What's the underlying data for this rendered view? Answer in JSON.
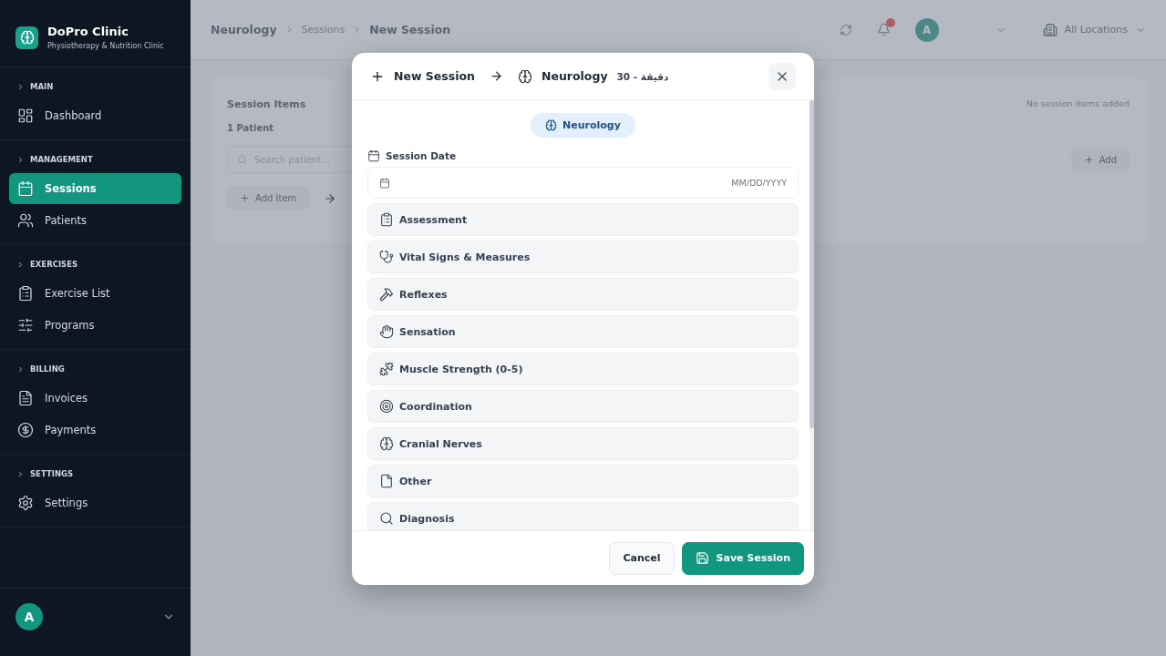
{
  "sidebar": {
    "brand": {
      "name": "DoPro Clinic",
      "subtitle": "Physiotherapy & Nutrition Clinic"
    },
    "sections": [
      {
        "title": "MAIN",
        "items": [
          {
            "label": "Dashboard",
            "selected": false
          }
        ]
      },
      {
        "title": "MANAGEMENT",
        "items": [
          {
            "label": "Sessions",
            "selected": true
          },
          {
            "label": "Patients",
            "selected": false
          }
        ]
      },
      {
        "title": "EXERCISES",
        "items": [
          {
            "label": "Exercise List",
            "selected": false
          },
          {
            "label": "Programs",
            "selected": false
          }
        ]
      },
      {
        "title": "BILLING",
        "items": [
          {
            "label": "Invoices",
            "selected": false
          },
          {
            "label": "Payments",
            "selected": false
          }
        ]
      },
      {
        "title": "SETTINGS",
        "items": [
          {
            "label": "Settings",
            "selected": false
          }
        ]
      }
    ],
    "user": {
      "avatar": "A"
    }
  },
  "header": {
    "breadcrumb": [
      "Neurology",
      "Sessions",
      "New Session"
    ],
    "avatar": "A",
    "location": "All Locations"
  },
  "page": {
    "title": "Session Items",
    "empty_note": "No session items added",
    "patient_label": "1 Patient",
    "search": {
      "placeholder": "Search patient..."
    },
    "add_button": "Add",
    "add_item_button": "Add Item"
  },
  "modal": {
    "title": "New Session",
    "specialty": "Neurology",
    "duration": "30 - دقيقة",
    "chip": "Neurology",
    "date_label": "Session Date",
    "date_placeholder": "MM/DD/YYYY",
    "sections": [
      {
        "label": "Assessment"
      },
      {
        "label": "Vital Signs & Measures"
      },
      {
        "label": "Reflexes"
      },
      {
        "label": "Sensation"
      },
      {
        "label": "Muscle Strength (0-5)"
      },
      {
        "label": "Coordination"
      },
      {
        "label": "Cranial Nerves"
      },
      {
        "label": "Other"
      },
      {
        "label": "Diagnosis"
      }
    ],
    "buttons": {
      "cancel": "Cancel",
      "save": "Save Session"
    }
  }
}
